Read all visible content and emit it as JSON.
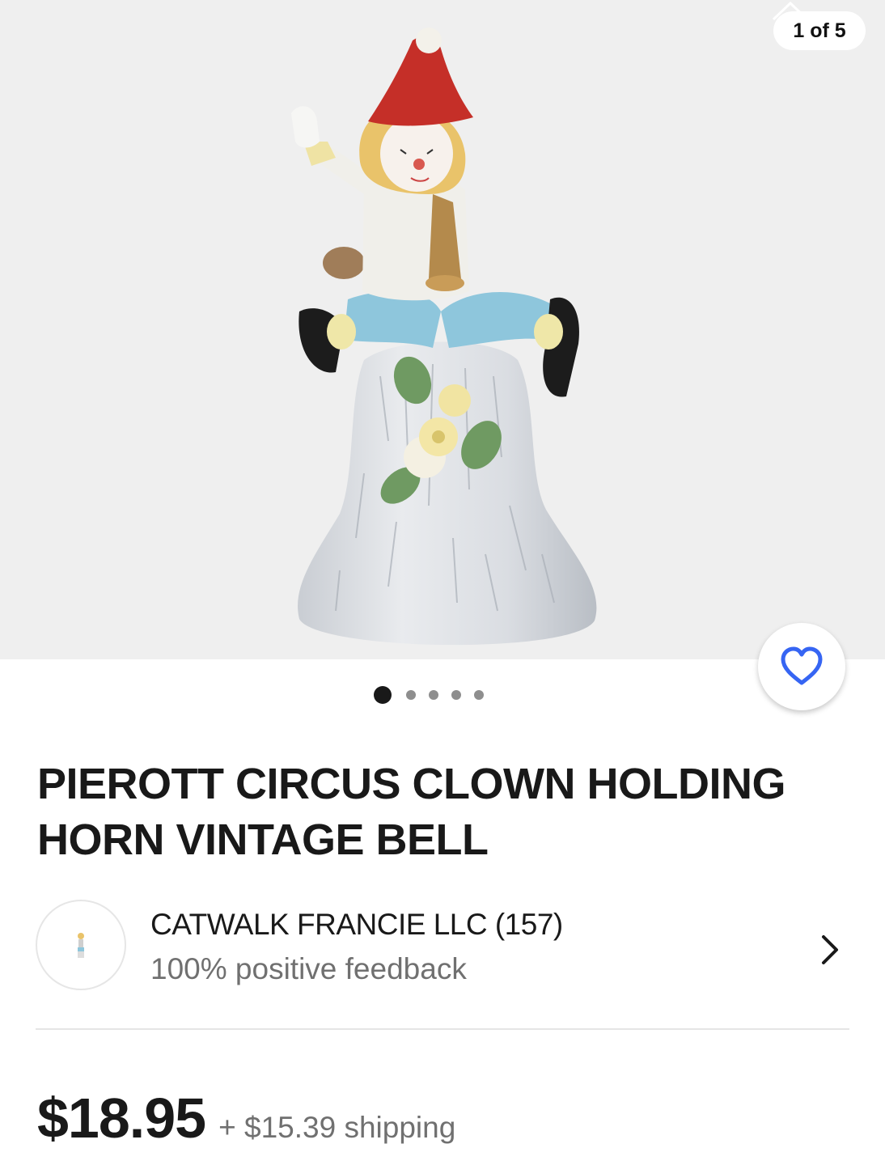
{
  "gallery": {
    "counter": "1 of 5",
    "total_images": 5,
    "active_index": 0
  },
  "listing": {
    "title": "PIEROTT CIRCUS CLOWN HOLDING HORN VINTAGE BELL"
  },
  "seller": {
    "name": "CATWALK FRANCIE LLC (157)",
    "feedback": "100% positive feedback"
  },
  "pricing": {
    "price": "$18.95",
    "shipping": "+ $15.39 shipping"
  },
  "icons": {
    "watch": "heart-icon",
    "seller_link": "chevron-right-icon",
    "collapse": "chevron-up-icon"
  },
  "colors": {
    "accent": "#3665f3",
    "text": "#191919",
    "muted": "#707070",
    "gallery_bg": "#efefef"
  }
}
